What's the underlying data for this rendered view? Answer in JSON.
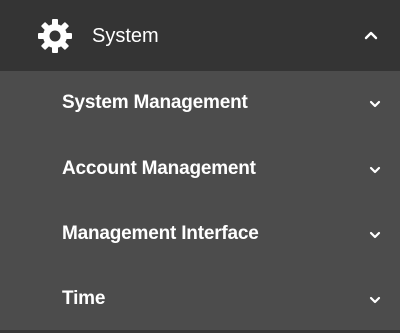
{
  "menu": {
    "section": {
      "label": "System",
      "icon": "gear-icon",
      "state_icon": "chevron-up-icon",
      "expanded": true,
      "colors": {
        "header_bg": "#343434",
        "submenu_bg": "#4c4c4c",
        "text": "#ffffff"
      }
    },
    "items": [
      {
        "label": "System Management",
        "icon": "chevron-down-icon"
      },
      {
        "label": "Account Management",
        "icon": "chevron-down-icon"
      },
      {
        "label": "Management Interface",
        "icon": "chevron-down-icon"
      },
      {
        "label": "Time",
        "icon": "chevron-down-icon"
      }
    ]
  }
}
